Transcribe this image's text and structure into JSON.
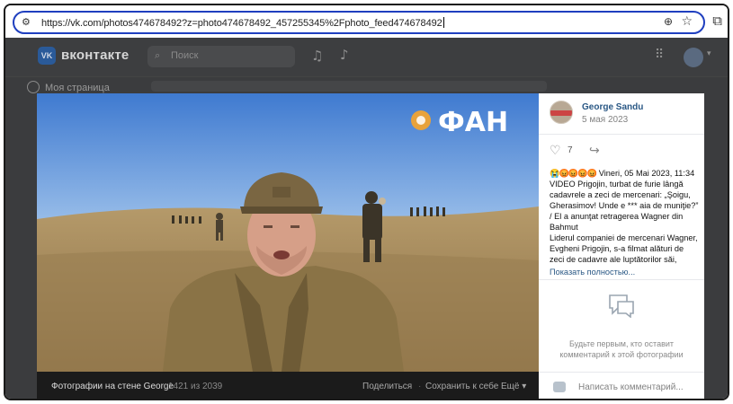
{
  "browser": {
    "url": "https://vk.com/photos474678492?z=photo474678492_457255345%2Fphoto_feed474678492",
    "site_icon": "tune-icon",
    "zoom_icon": "zoom-icon",
    "star_icon": "star-icon",
    "extensions_icon": "extensions-icon"
  },
  "vk": {
    "brand": "вконтакте",
    "logo": "VK",
    "search_placeholder": "Поиск",
    "sidebar_item": "Моя страница"
  },
  "photo": {
    "watermark": "ФАН",
    "caption": "Фотографии на стене George",
    "counter": "1421 из 2039",
    "actions": {
      "share": "Поделиться",
      "save": "Сохранить к себе",
      "more": "Ещё"
    }
  },
  "panel": {
    "author": "George Sandu",
    "date": "5 мая 2023",
    "likes": "7",
    "emoji": "😭😡😡😡😡",
    "post_line1": "Vineri, 05 Mai 2023, 11:34",
    "post_line2": "VIDEO Prigojin, turbat de furie lângă cadavrele a zeci de mercenari: „Şoigu, Gherasimov! Unde e *** aia de muniţie?” / El a anunţat retragerea Wagner din Bahmut",
    "post_line3": "Liderul companiei de mercenari Wagner, Evgheni Prigojin, s-a filmat alături de zeci de cadavre ale luptătorilor săi,",
    "show_more": "Показать полностью...",
    "empty_comments": "Будьте первым, кто оставит комментарий к этой фотографии",
    "comment_placeholder": "Написать комментарий..."
  },
  "colors": {
    "link": "#2a5885",
    "address_border": "#1f3fbf",
    "watermark": "#e8a23a"
  }
}
